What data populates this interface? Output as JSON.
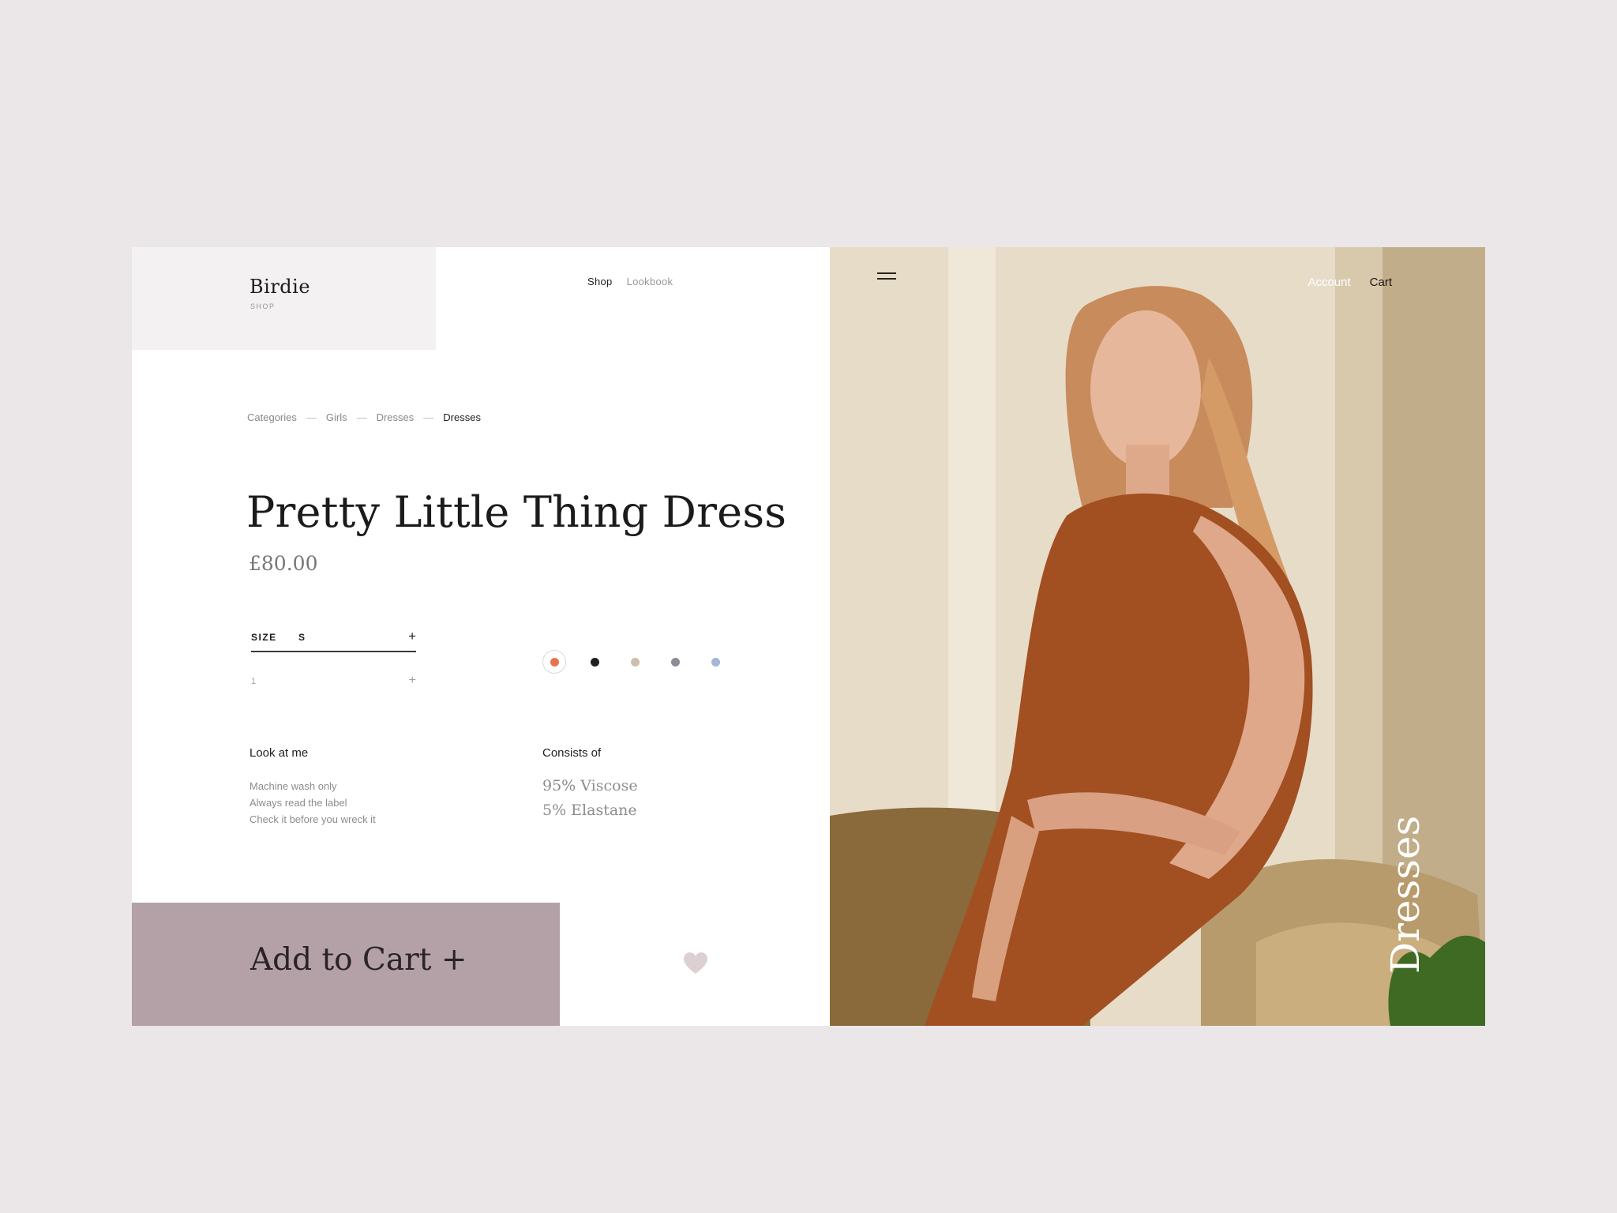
{
  "brand": {
    "name": "Birdie",
    "sub": "SHOP"
  },
  "nav": {
    "shop": "Shop",
    "lookbook": "Lookbook",
    "account": "Account",
    "cart": "Cart"
  },
  "breadcrumb": [
    "Categories",
    "Girls",
    "Dresses",
    "Dresses"
  ],
  "breadcrumb_sep": "—",
  "product": {
    "title": "Pretty Little Thing Dress",
    "price": "£80.00",
    "size_label": "SIZE",
    "size_value": "S",
    "size_plus": "+",
    "quantity": "1",
    "qty_plus": "+"
  },
  "colors": {
    "selected_index": 0,
    "swatches": [
      "#e8734a",
      "#1f1f1f",
      "#cdbfae",
      "#8f8b97",
      "#a2b6d6"
    ]
  },
  "care": {
    "title": "Look at me",
    "items": [
      "Machine wash only",
      "Always read the label",
      "Check it before you wreck it"
    ]
  },
  "composition": {
    "title": "Consists of",
    "items": [
      "95% Viscose",
      "5% Elastane"
    ]
  },
  "cta": {
    "add_to_cart": "Add to Cart +"
  },
  "hero": {
    "vertical_label": "Dresses"
  },
  "palette": {
    "cta_bg": "#b4a1a7",
    "heart": "#dcd0d3",
    "dress": "#a24f22"
  }
}
